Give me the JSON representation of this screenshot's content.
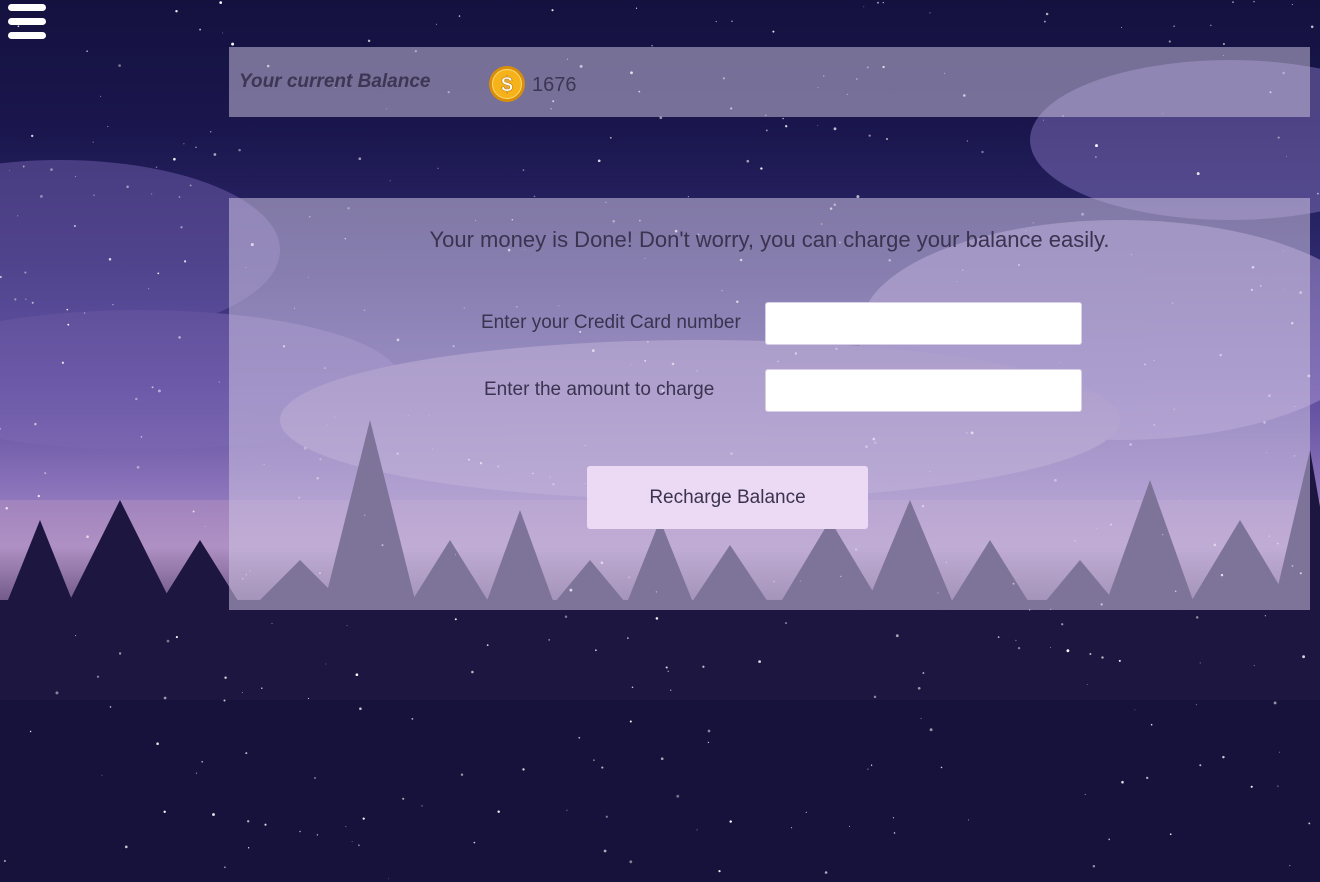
{
  "menu": {
    "icon": "hamburger-menu-icon"
  },
  "balance": {
    "label": "Your current Balance",
    "coin_icon": "dollar-coin-icon",
    "value": "1676"
  },
  "recharge": {
    "message": "Your money is Done! Don't worry, you can charge your balance easily.",
    "credit_card_label": "Enter your Credit Card number",
    "credit_card_value": "",
    "amount_label": "Enter the amount to charge",
    "amount_value": "",
    "button_label": "Recharge Balance"
  },
  "colors": {
    "coin_gold": "#f5b21a",
    "coin_rim": "#d98e0b",
    "button_bg": "#ecdaf5",
    "text_dark": "#3b3350",
    "sky_top": "#14113f",
    "tree_dark": "#1d1640"
  }
}
